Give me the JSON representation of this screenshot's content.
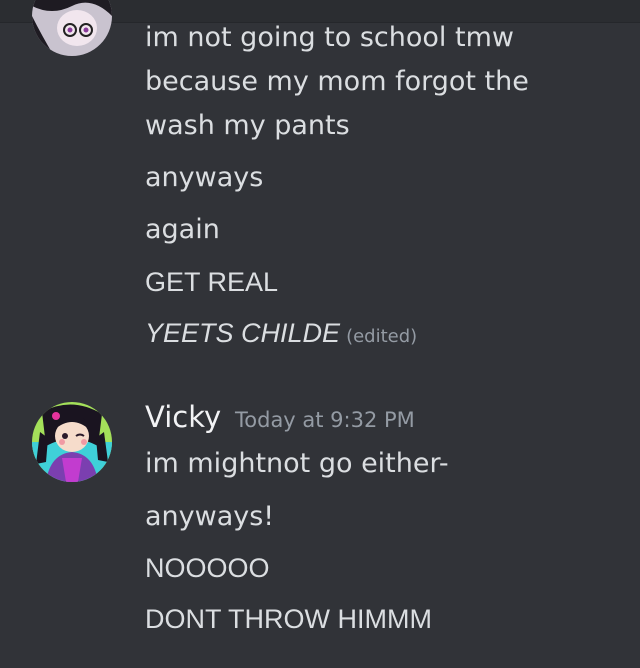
{
  "messages_prev": {
    "line1": "im not going to school tmw",
    "line2": "because my mom forgot the",
    "line3": "wash my pants",
    "line4": "anyways",
    "line5": "again",
    "line6": "GET REAL",
    "line7": "YEETS CHILDE",
    "edited_label": "(edited)"
  },
  "vicky": {
    "username": "Vicky",
    "timestamp": "Today at 9:32 PM",
    "line1": "im mightnot go either-",
    "line2": "anyways!",
    "line3": "NOOOOO",
    "line4": "DONT THROW HIMMM"
  },
  "colors": {
    "background": "#313338",
    "text": "#dbdee1",
    "muted": "#949ba4"
  }
}
